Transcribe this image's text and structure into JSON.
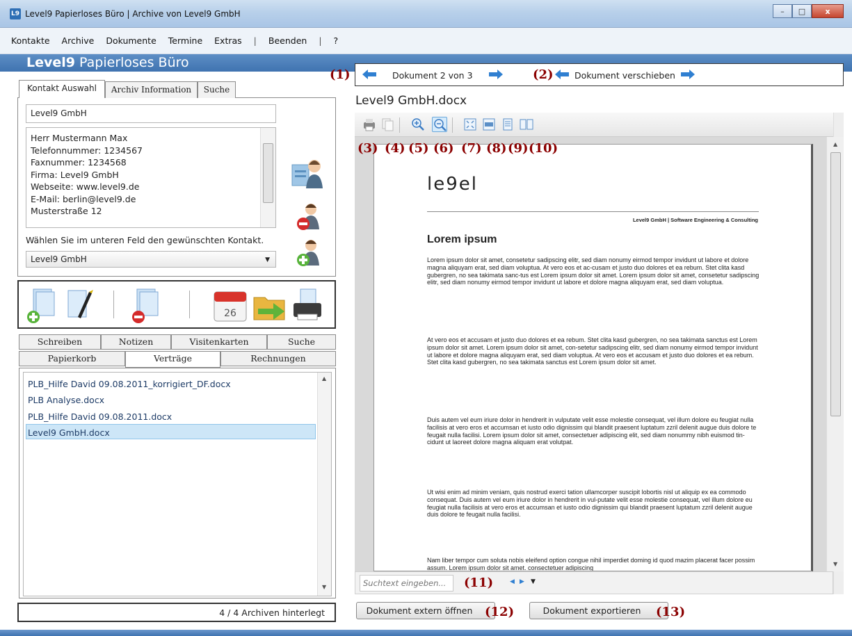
{
  "window": {
    "title": "Level9 Papierloses Büro | Archive von Level9 GmbH",
    "icon_text": "L9",
    "minimize": "–",
    "maximize": "□",
    "close": "x"
  },
  "menu": [
    "Kontakte",
    "Archive",
    "Dokumente",
    "Termine",
    "Extras",
    "|",
    "Beenden",
    "|",
    "?"
  ],
  "header": {
    "brand_bold": "Level9",
    "brand_rest": " Papierloses Büro"
  },
  "contact_panel": {
    "tabs": [
      "Kontakt Auswahl",
      "Archiv Information",
      "Suche"
    ],
    "name_field": "Level9 GmbH",
    "details": [
      "Herr Mustermann Max",
      "Telefonnummer: 1234567",
      "Faxnummer: 1234568",
      "Firma: Level9 GmbH",
      "Webseite: www.level9.de",
      "E-Mail: berlin@level9.de",
      "Musterstraße 12"
    ],
    "hint": "Wählen Sie im unteren Feld den gewünschten Kontakt.",
    "dropdown_value": "Level9 GmbH"
  },
  "doc_tabs": {
    "row1": [
      "Schreiben",
      "Notizen",
      "Visitenkarten",
      "Suche"
    ],
    "row2": [
      "Papierkorb",
      "Verträge",
      "Rechnungen"
    ]
  },
  "documents": [
    "PLB_Hilfe David 09.08.2011_korrigiert_DF.docx",
    "PLB Analyse.docx",
    "PLB_Hilfe David 09.08.2011.docx",
    "Level9 GmbH.docx"
  ],
  "status": "4 / 4 Archiven hinterlegt",
  "nav": {
    "doc_counter": "Dokument 2 von 3",
    "move_label": "Dokument verschieben"
  },
  "doc_title": "Level9 GmbH.docx",
  "annotations": [
    "(1)",
    "(2)",
    "(3)",
    "(4)",
    "(5)",
    "(6)",
    "(7)",
    "(8)",
    "(9)",
    "(10)",
    "(11)",
    "(12)",
    "(13)"
  ],
  "page": {
    "logo": "le9el",
    "company_line": "Level9 GmbH | Software Engineering & Consulting",
    "heading": "Lorem ipsum",
    "paragraphs": [
      "Lorem ipsum dolor sit amet, consetetur sadipscing elitr, sed diam nonumy eirmod tempor invidunt ut labore et dolore magna aliquyam erat, sed diam voluptua. At vero eos et ac-cusam et justo duo dolores et ea rebum. Stet clita kasd gubergren, no sea takimata sanc-tus est Lorem ipsum dolor sit amet. Lorem ipsum dolor sit amet, consetetur sadipscing elitr, sed diam nonumy eirmod tempor invidunt ut labore et dolore magna aliquyam erat, sed diam voluptua.",
      "At vero eos et accusam et justo duo dolores et ea rebum. Stet clita kasd gubergren, no sea takimata sanctus est Lorem ipsum dolor sit amet. Lorem ipsum dolor sit amet, con-setetur sadipscing elitr, sed diam nonumy eirmod tempor invidunt ut labore et dolore magna aliquyam erat, sed diam voluptua. At vero eos et accusam et justo duo dolores et ea rebum. Stet clita kasd gubergren, no sea takimata sanctus est Lorem ipsum dolor sit amet.",
      "Duis autem vel eum iriure dolor in hendrerit in vulputate velit esse molestie consequat, vel illum dolore eu feugiat nulla facilisis at vero eros et accumsan et iusto odio dignissim qui blandit praesent luptatum zzril delenit augue duis dolore te feugait nulla facilisi. Lorem ipsum dolor sit amet, consectetuer adipiscing elit, sed diam nonummy nibh euismod tin-cidunt ut laoreet dolore magna aliquam erat volutpat.",
      "Ut wisi enim ad minim veniam, quis nostrud exerci tation ullamcorper suscipit lobortis nisl ut aliquip ex ea commodo consequat. Duis autem vel eum iriure dolor in hendrerit in vul-putate velit esse molestie consequat, vel illum dolore eu feugiat nulla facilisis at vero eros et accumsan et iusto odio dignissim qui blandit praesent luptatum zzril delenit augue duis dolore te feugait nulla facilisi.",
      "Nam liber tempor cum soluta nobis eleifend option congue nihil imperdiet doming id quod mazim placerat facer possim assum. Lorem ipsum dolor sit amet. consectetuer adipiscing"
    ]
  },
  "search": {
    "placeholder": "Suchtext eingeben..."
  },
  "buttons": {
    "open_external": "Dokument extern öffnen",
    "export": "Dokument exportieren"
  },
  "colors": {
    "brand_blue": "#3f73b0",
    "annotation": "#8b0000",
    "arrow_blue": "#2f7fd1",
    "selection": "#cde6f7"
  }
}
